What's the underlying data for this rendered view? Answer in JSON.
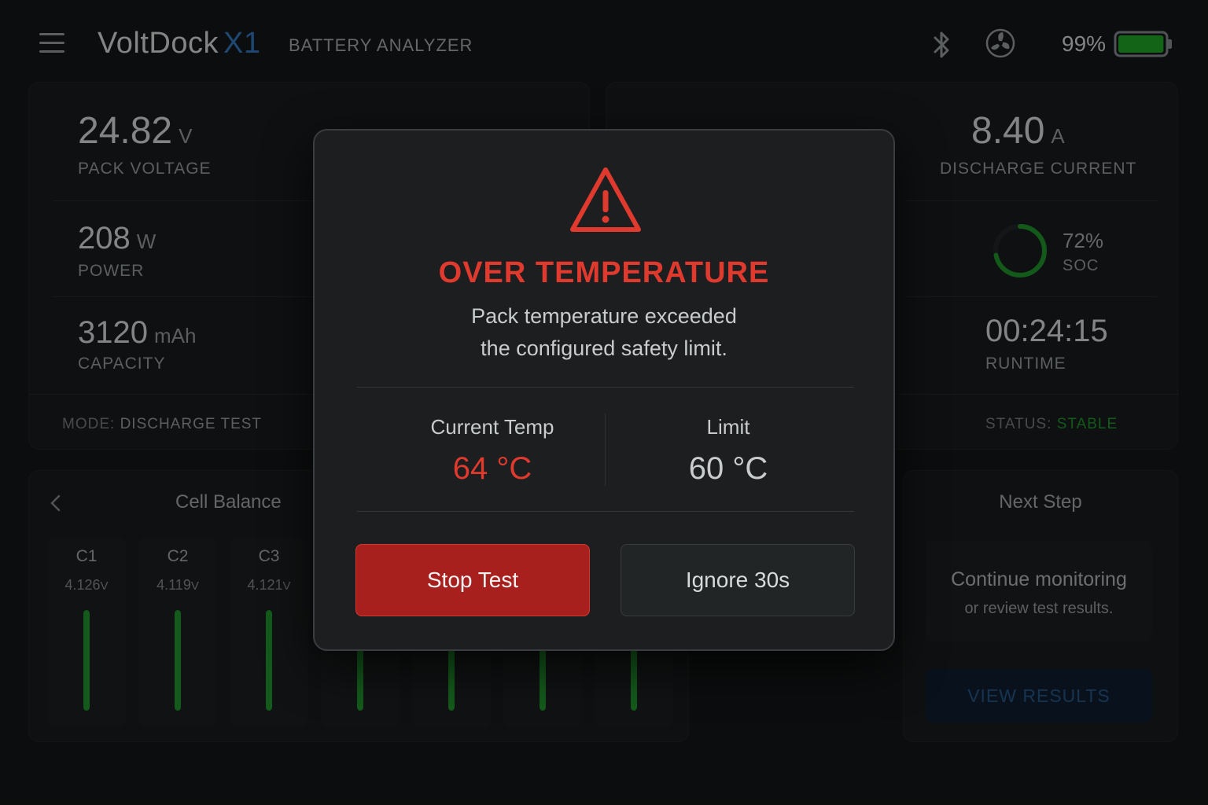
{
  "header": {
    "brand": "VoltDock",
    "model": "X1",
    "subtitle": "BATTERY ANALYZER",
    "battery_percent": "99%",
    "battery_level": 0.99,
    "icons": [
      "menu-icon",
      "bluetooth-icon",
      "fan-icon",
      "battery-icon"
    ]
  },
  "left_panel": {
    "voltage": {
      "value": "24.82",
      "unit": "V",
      "label": "PACK VOLTAGE"
    },
    "power": {
      "value": "208",
      "unit": "W",
      "label": "POWER"
    },
    "capacity": {
      "value": "3120",
      "unit": "mAh",
      "label": "CAPACITY"
    },
    "mode_key": "MODE:",
    "mode_value": "DISCHARGE TEST"
  },
  "right_panel": {
    "current": {
      "value": "8.40",
      "unit": "A",
      "label": "DISCHARGE CURRENT"
    },
    "soc": {
      "value": "72%",
      "label": "SOC",
      "fraction": 0.72
    },
    "runtime": {
      "value": "00:24:15",
      "label": "RUNTIME"
    },
    "status_key": "STATUS:",
    "status_value": "STABLE"
  },
  "cell_balance": {
    "title": "Cell Balance",
    "cells": [
      {
        "name": "C1",
        "voltage": "4.126",
        "unit": "V"
      },
      {
        "name": "C2",
        "voltage": "4.119",
        "unit": "V"
      },
      {
        "name": "C3",
        "voltage": "4.121",
        "unit": "V"
      }
    ]
  },
  "next_step": {
    "title": "Next Step",
    "line1": "Continue monitoring",
    "line2": "or review test results.",
    "button": "VIEW RESULTS"
  },
  "modal": {
    "title": "OVER TEMPERATURE",
    "message_line1": "Pack temperature exceeded",
    "message_line2": "the configured safety limit.",
    "current_label": "Current Temp",
    "current_value": "64 °C",
    "limit_label": "Limit",
    "limit_value": "60 °C",
    "stop_button": "Stop Test",
    "ignore_button": "Ignore 30s"
  },
  "colors": {
    "alert_red": "#e03a2f",
    "accent_blue": "#2f6fb0",
    "ok_green": "#1f8a2c",
    "background": "#131516"
  }
}
